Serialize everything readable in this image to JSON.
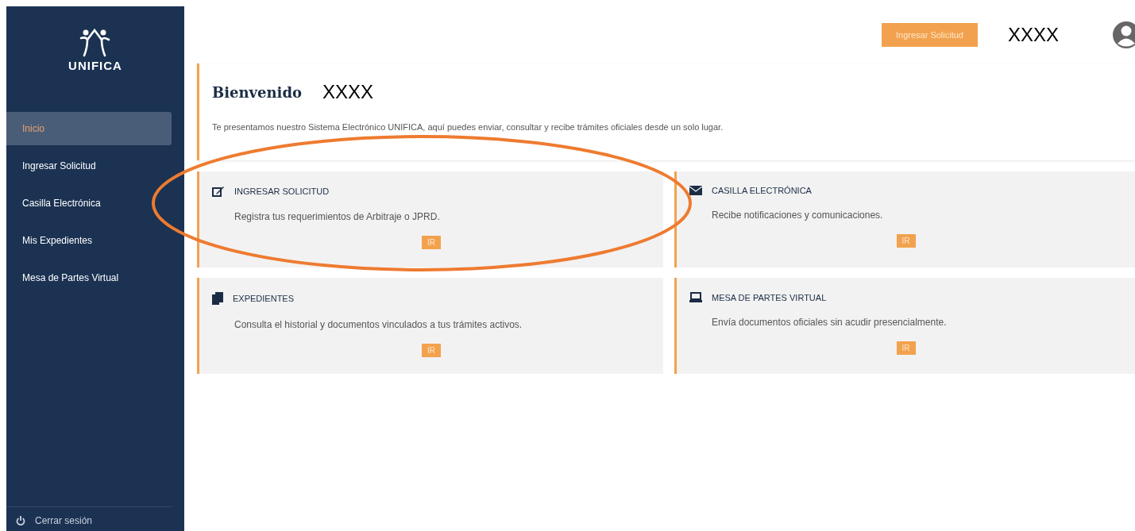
{
  "sidebar": {
    "logo_text": "UNIFICA",
    "items": [
      {
        "label": "Inicio",
        "selected": true
      },
      {
        "label": "Ingresar Solicitud",
        "selected": false
      },
      {
        "label": "Casilla Electrónica",
        "selected": false
      },
      {
        "label": "Mis Expedientes",
        "selected": false
      },
      {
        "label": "Mesa de Partes Virtual",
        "selected": false
      }
    ],
    "logout": "Cerrar sesión"
  },
  "header": {
    "button": "Ingresar Solicitud",
    "user": "XXXX"
  },
  "welcome": {
    "title": "Bienvenido",
    "name": "XXXX",
    "text": "Te presentamos nuestro Sistema Electrónico UNIFICA, aquí puedes enviar, consultar y recibe trámites oficiales desde un solo lugar."
  },
  "cards": [
    {
      "kind": "edit",
      "title": "INGRESAR SOLICITUD",
      "text": "Registra tus requerimientos de Arbitraje o JPRD.",
      "button": "IR",
      "highlighted": true
    },
    {
      "kind": "mail",
      "title": "CASILLA ELECTRÓNICA",
      "text": "Recibe notificaciones y comunicaciones.",
      "button": "IR",
      "highlighted": false
    },
    {
      "kind": "files",
      "title": "EXPEDIENTES",
      "text": "Consulta el historial y documentos vinculados a tus trámites activos.",
      "button": "IR",
      "highlighted": false
    },
    {
      "kind": "laptop",
      "title": "MESA DE PARTES VIRTUAL",
      "text": "Envía documentos oficiales sin acudir presencialmente.",
      "button": "IR",
      "highlighted": false
    }
  ]
}
